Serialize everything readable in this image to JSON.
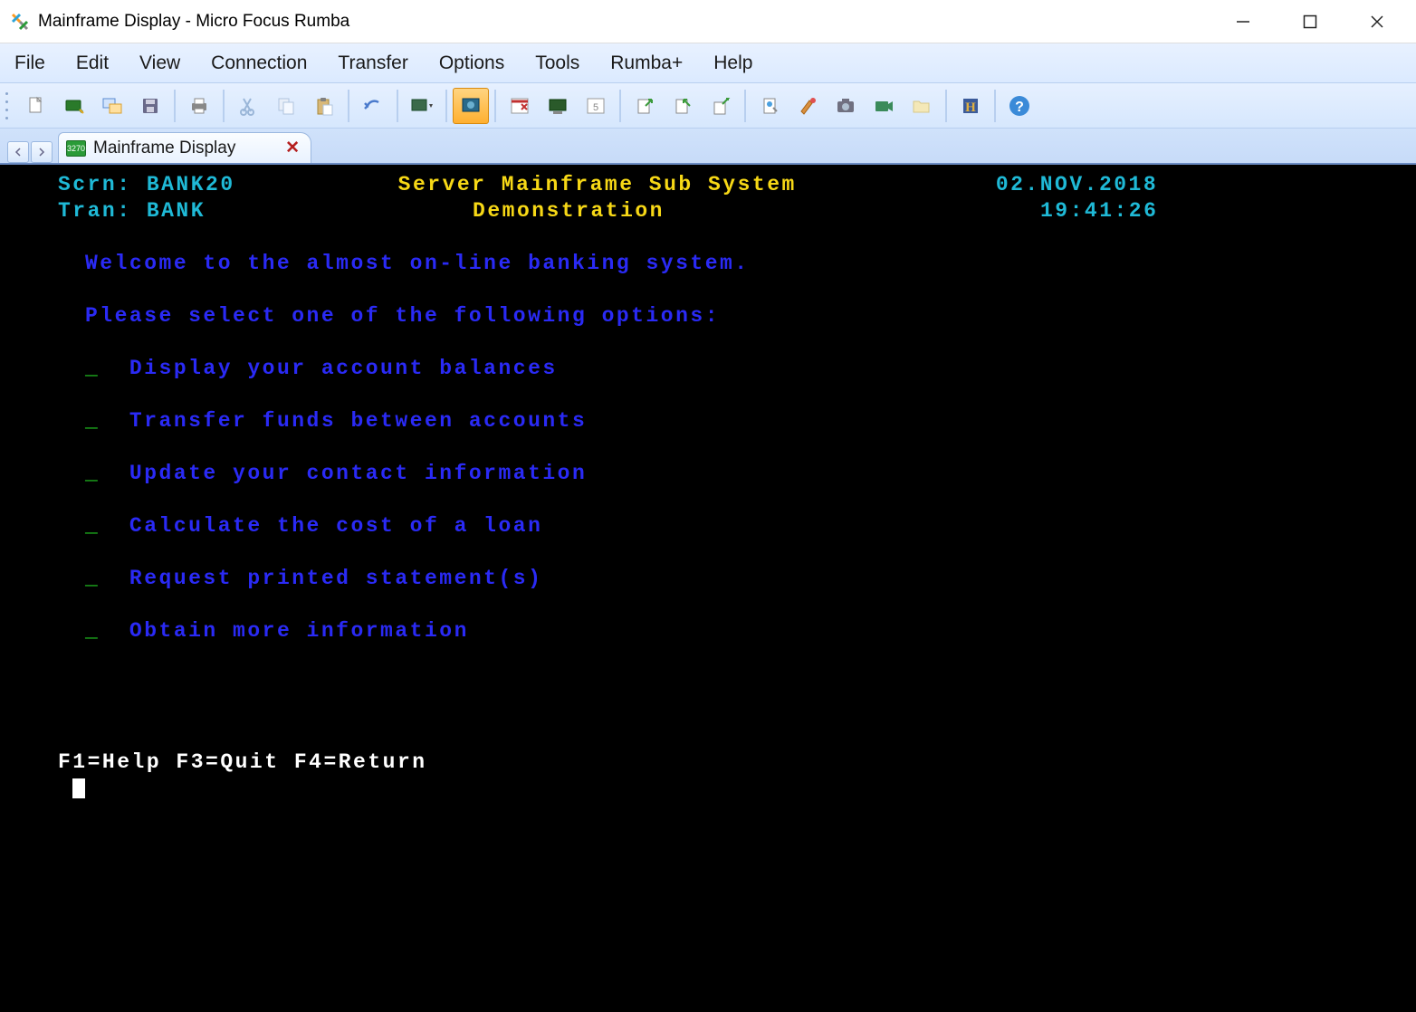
{
  "window": {
    "title": "Mainframe Display - Micro Focus Rumba"
  },
  "menus": [
    "File",
    "Edit",
    "View",
    "Connection",
    "Transfer",
    "Options",
    "Tools",
    "Rumba+",
    "Help"
  ],
  "tab": {
    "label": "Mainframe Display"
  },
  "toolbar_icons": [
    "new-file",
    "connect",
    "session",
    "save",
    "print",
    "cut",
    "copy",
    "paste",
    "undo",
    "screen-dropdown",
    "screen-active",
    "macro",
    "host",
    "keyboard",
    "send",
    "receive",
    "upload",
    "properties",
    "colors",
    "capture",
    "recorder",
    "folder",
    "history",
    "help"
  ],
  "terminal": {
    "header": {
      "scrn_label": "Scrn:",
      "scrn_value": "BANK20",
      "tran_label": "Tran:",
      "tran_value": "BANK",
      "title1": "Server Mainframe Sub System",
      "title2": "Demonstration",
      "date": "02.NOV.2018",
      "time": "19:41:26"
    },
    "welcome": "Welcome to the almost on-line banking system.",
    "prompt": "Please select one of the following options:",
    "options": [
      "Display your account balances",
      "Transfer funds between accounts",
      "Update your contact information",
      "Calculate the cost of a loan",
      "Request printed statement(s)",
      "Obtain more information"
    ],
    "fkeys": "F1=Help F3=Quit F4=Return"
  }
}
